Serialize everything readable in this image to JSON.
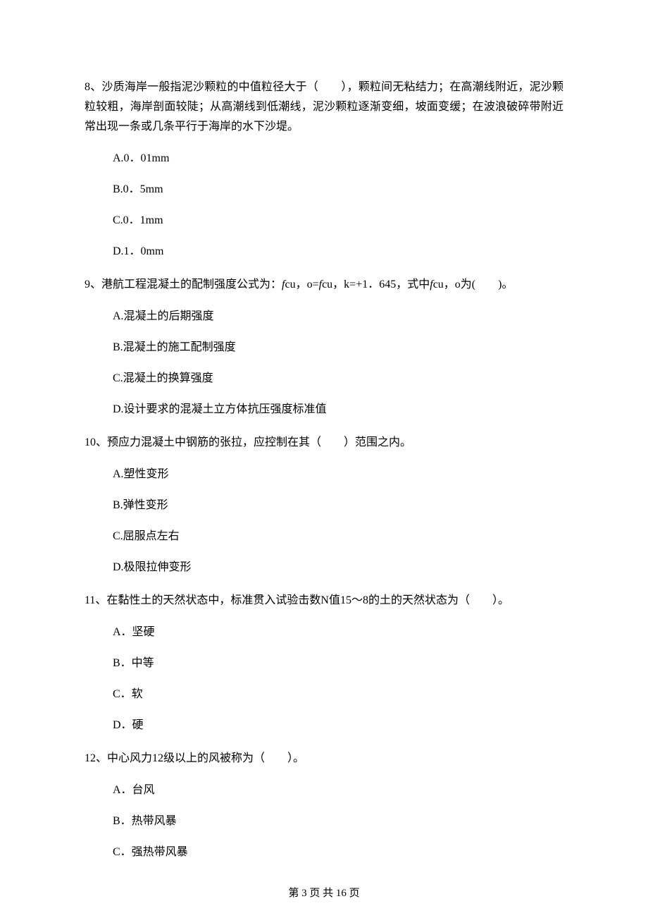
{
  "questions": [
    {
      "num": "8、",
      "stem_before": "沙质海岸一般指泥沙颗粒的中值粒径大于（",
      "stem_blank": "　　",
      "stem_after": "），颗粒间无粘结力；在高潮线附近，泥沙颗粒较粗，海岸剖面较陡；从高潮线到低潮线，泥沙颗粒逐渐变细，坡面变缓；在波浪破碎带附近常出现一条或几条平行于海岸的水下沙堤。",
      "options": [
        "A.0．01mm",
        "B.0．5mm",
        "C.0．1mm",
        "D.1．0mm"
      ]
    },
    {
      "num": "9、",
      "stem_parts": [
        {
          "t": "港航工程混凝土的配制强度公式为："
        },
        {
          "t": "f",
          "italic": true
        },
        {
          "t": "cu，o="
        },
        {
          "t": "f",
          "italic": true
        },
        {
          "t": "cu，k=+1．645，式中"
        },
        {
          "t": "f",
          "italic": true
        },
        {
          "t": "cu，o为(　　)。"
        }
      ],
      "options": [
        "A.混凝土的后期强度",
        "B.混凝土的施工配制强度",
        "C.混凝土的换算强度",
        "D.设计要求的混凝土立方体抗压强度标准值"
      ]
    },
    {
      "num": "10、",
      "stem_before": "预应力混凝土中钢筋的张拉，应控制在其（",
      "stem_blank": "　　",
      "stem_after": "）范围之内。",
      "options": [
        "A.塑性变形",
        "B.弹性变形",
        "C.屈服点左右",
        "D.极限拉伸变形"
      ]
    },
    {
      "num": "11、",
      "stem_before": "在黏性土的天然状态中，标准贯入试验击数N值15～8的土的天然状态为（",
      "stem_blank": "　　",
      "stem_after": "）。",
      "options": [
        "A．坚硬",
        "B．中等",
        "C．软",
        "D．硬"
      ]
    },
    {
      "num": "12、",
      "stem_before": "中心风力12级以上的风被称为（",
      "stem_blank": "　　",
      "stem_after": "）。",
      "options": [
        "A．台风",
        "B．热带风暴",
        "C．强热带风暴"
      ]
    }
  ],
  "pager": {
    "prefix": "第 ",
    "current": "3",
    "middle": " 页 共 ",
    "total": "16",
    "suffix": " 页"
  }
}
